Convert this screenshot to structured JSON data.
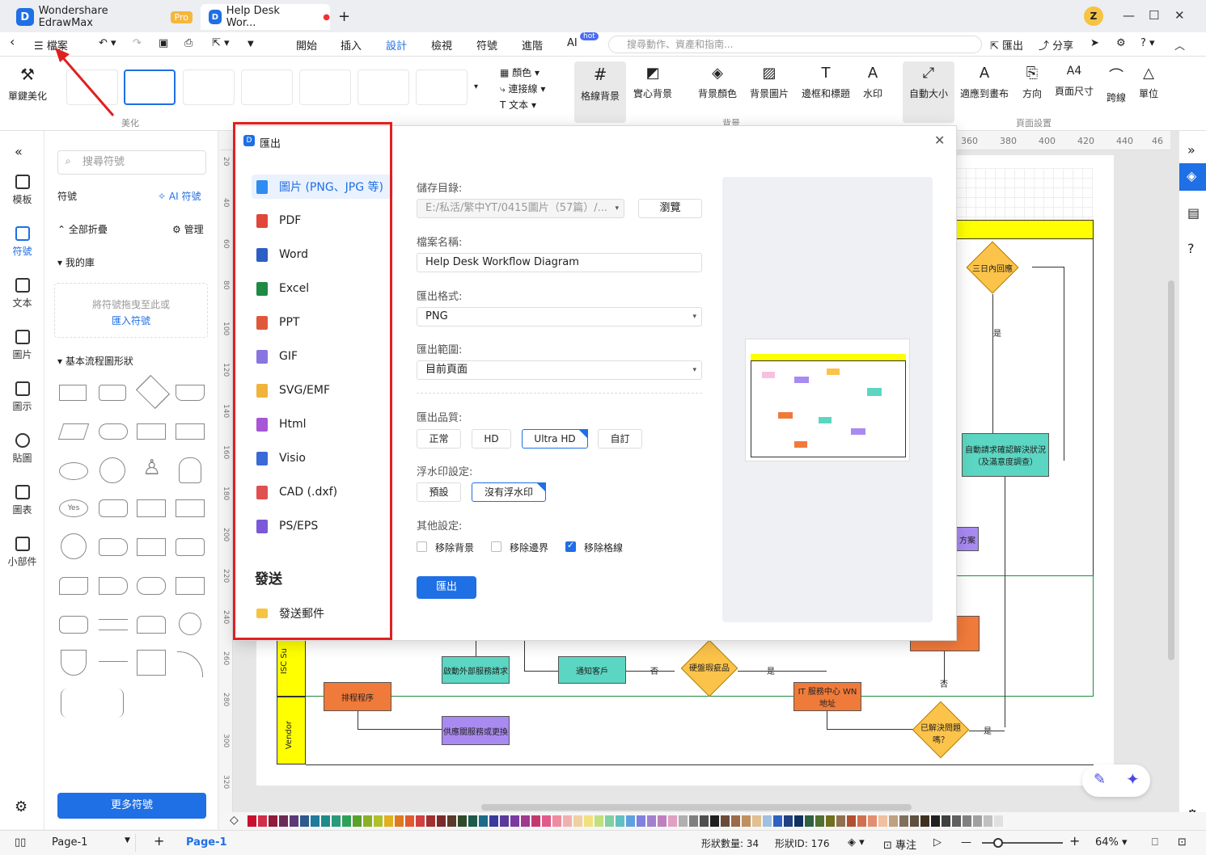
{
  "titlebar": {
    "app_title": "Wondershare EdrawMax",
    "pro_badge": "Pro",
    "doc_tab": "Help Desk Wor...",
    "new_tab": "+",
    "user_initial": "Z"
  },
  "menubar": {
    "file": "檔案",
    "items": [
      "開始",
      "插入",
      "設計",
      "檢視",
      "符號",
      "進階",
      "AI"
    ],
    "active": "設計",
    "ai_badge": "hot",
    "search_placeholder": "搜尋動作、資產和指南...",
    "export": "匯出",
    "share": "分享"
  },
  "ribbon": {
    "one_click": "單鍵美化",
    "theme_group_label": "美化",
    "color": "顏色",
    "connector": "連接線",
    "text": "文本",
    "grid_bg": "格線背景",
    "solid_bg": "實心背景",
    "bg_color": "背景顏色",
    "bg_image": "背景圖片",
    "border_title": "邊框和標題",
    "watermark": "水印",
    "bg_group": "背景",
    "auto_size": "自動大小",
    "fit_canvas": "適應到畫布",
    "orientation": "方向",
    "page_size": "頁面尺寸",
    "jump": "跨線",
    "unit": "單位",
    "page_setup_group": "頁面設置"
  },
  "leftnav": {
    "items": [
      "模板",
      "符號",
      "文本",
      "圖片",
      "圖示",
      "貼圖",
      "圖表",
      "小部件"
    ]
  },
  "sympanel": {
    "search_placeholder": "搜尋符號",
    "symbols_title": "符號",
    "ai_symbols": "AI 符號",
    "collapse_all": "全部折疊",
    "manage": "管理",
    "my_library": "我的庫",
    "drop_hint": "將符號拖曳至此或",
    "import_link": "匯入符號",
    "basic_flowchart": "基本流程圖形狀",
    "yes_label": "Yes",
    "more_symbols": "更多符號"
  },
  "ruler": {
    "top": [
      "360",
      "380",
      "400",
      "420",
      "440",
      "46"
    ],
    "left": [
      "20",
      "40",
      "60",
      "80",
      "100",
      "120",
      "140",
      "160",
      "180",
      "200",
      "220",
      "240",
      "260",
      "280",
      "300",
      "320"
    ]
  },
  "diagram": {
    "lane_isc": "ISC Su",
    "lane_vendor": "Vendor",
    "d_three_days": "三日內回應",
    "yes1": "是",
    "auto_request": "自動請求確認解決狀況（及滿意度調查）",
    "start_external": "啟動外部服務請求",
    "notify_customer": "通知客戶",
    "hardware_issue": "硬盤瑕疵品",
    "no": "否",
    "yes": "是",
    "it_service": "IT 服務中心 WN 地址",
    "schedule": "排程程序",
    "vendor_repair": "供應關服務或更換",
    "solved": "已解決問題嗎？",
    "no2": "否",
    "yes2": "是",
    "notify_short": "通知",
    "purple_short": "方案"
  },
  "dialog": {
    "title": "匯出",
    "formats": [
      {
        "label": "圖片 (PNG、JPG 等)",
        "color": "#2f8cf0"
      },
      {
        "label": "PDF",
        "color": "#e0463a"
      },
      {
        "label": "Word",
        "color": "#2b5fc4"
      },
      {
        "label": "Excel",
        "color": "#1e8a45"
      },
      {
        "label": "PPT",
        "color": "#e0583a"
      },
      {
        "label": "GIF",
        "color": "#8a74e0"
      },
      {
        "label": "SVG/EMF",
        "color": "#f0b43a"
      },
      {
        "label": "Html",
        "color": "#a855d8"
      },
      {
        "label": "Visio",
        "color": "#3a6ad8"
      },
      {
        "label": "CAD (.dxf)",
        "color": "#e05050"
      },
      {
        "label": "PS/EPS",
        "color": "#7a5ad8"
      }
    ],
    "send_title": "發送",
    "send_email": "發送郵件",
    "save_dir_label": "儲存目錄:",
    "save_dir_value": "E:/私活/繁中YT/0415圖片（57篇）/...",
    "browse": "瀏覽",
    "filename_label": "檔案名稱:",
    "filename_value": "Help Desk Workflow Diagram",
    "format_label": "匯出格式:",
    "format_value": "PNG",
    "range_label": "匯出範圍:",
    "range_value": "目前頁面",
    "quality_label": "匯出品質:",
    "quality_options": [
      "正常",
      "HD",
      "Ultra HD",
      "自訂"
    ],
    "quality_selected": "Ultra HD",
    "watermark_label": "浮水印設定:",
    "watermark_options": [
      "預設",
      "沒有浮水印"
    ],
    "watermark_selected": "沒有浮水印",
    "other_label": "其他設定:",
    "checks": [
      {
        "label": "移除背景",
        "checked": false
      },
      {
        "label": "移除邊界",
        "checked": false
      },
      {
        "label": "移除格線",
        "checked": true
      }
    ],
    "export_button": "匯出"
  },
  "statusbar": {
    "page_select": "Page-1",
    "page_tab": "Page-1",
    "shape_count": "形狀數量: 34",
    "shape_id": "形狀ID: 176",
    "focus": "專注",
    "zoom": "64%"
  },
  "palette": [
    "#c8102e",
    "#d12e4a",
    "#8e1c3a",
    "#6b2b55",
    "#5a3a78",
    "#2e5a8c",
    "#1f7a9c",
    "#1e8a8a",
    "#2a9a7a",
    "#2fa05a",
    "#5aa02e",
    "#8ab02a",
    "#b0c02a",
    "#e0b020",
    "#e07a20",
    "#e05a30",
    "#d04040",
    "#a03030",
    "#7a2a2a",
    "#5a3a2a",
    "#2e4a2a",
    "#1e5a4a",
    "#1e6a8a",
    "#3a3a9a",
    "#5a3a9a",
    "#7a3aa0",
    "#a03a90",
    "#c03a70",
    "#e05a8a",
    "#f08aa0",
    "#f0b0b0",
    "#f0d0a0",
    "#f0e080",
    "#c0e080",
    "#80d0a0",
    "#60c0c0",
    "#60a0e0",
    "#8080e0",
    "#a080d0",
    "#c080c0",
    "#e0a0c0",
    "#b0b0b0",
    "#808080",
    "#505050",
    "#202020",
    "#6a4a3a",
    "#9a6a4a",
    "#c09060",
    "#e0c090",
    "#a0c0e0",
    "#3060c0",
    "#204080",
    "#103060",
    "#306040",
    "#507030",
    "#707020",
    "#907050",
    "#b05030",
    "#d07050",
    "#e09070",
    "#f0c0a0",
    "#c0a080",
    "#807060",
    "#605040",
    "#403020",
    "#202020",
    "#404040",
    "#606060",
    "#808080",
    "#a0a0a0",
    "#c0c0c0",
    "#e0e0e0"
  ]
}
